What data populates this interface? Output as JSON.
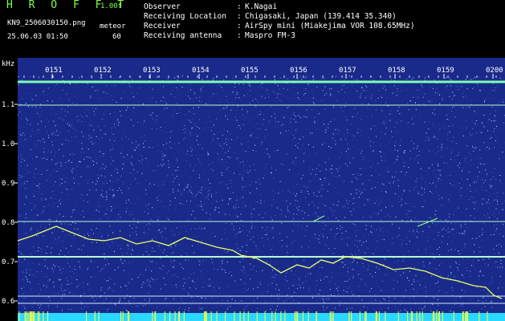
{
  "header": {
    "app_title": "H R O F F T",
    "version": "1.00f",
    "file_name": "KN9_2506030150.png",
    "meteor_label": "meteor",
    "datetime": "25.06.03 01:50",
    "meteor_count": "60",
    "meta": [
      {
        "label": "Observer",
        "value": "K.Nagai"
      },
      {
        "label": "Receiving Location",
        "value": "Chigasaki, Japan (139.414 35.340)"
      },
      {
        "label": "Receiver",
        "value": "AirSpy mini (Miakejima VOR 108.65MHz)"
      },
      {
        "label": "Receiving antenna",
        "value": "Maspro FM-3"
      }
    ]
  },
  "spectrogram": {
    "y_unit": "kHz",
    "y_ticks": [
      "1.1",
      "1.0",
      "0.9",
      "0.8",
      "0.7",
      "0.6"
    ],
    "x_ticks": [
      "0151",
      "0152",
      "0153",
      "0154",
      "0155",
      "0156",
      "0157",
      "0158",
      "0159",
      "0200"
    ],
    "colors": {
      "background": "#1a2a8a",
      "noise_bright": "#a9f0ff",
      "line": "#b8ffd0",
      "trace": "#e8ff6a",
      "bottom_band": "#2ad8ff",
      "bottom_spike": "#ffff3a"
    }
  }
}
